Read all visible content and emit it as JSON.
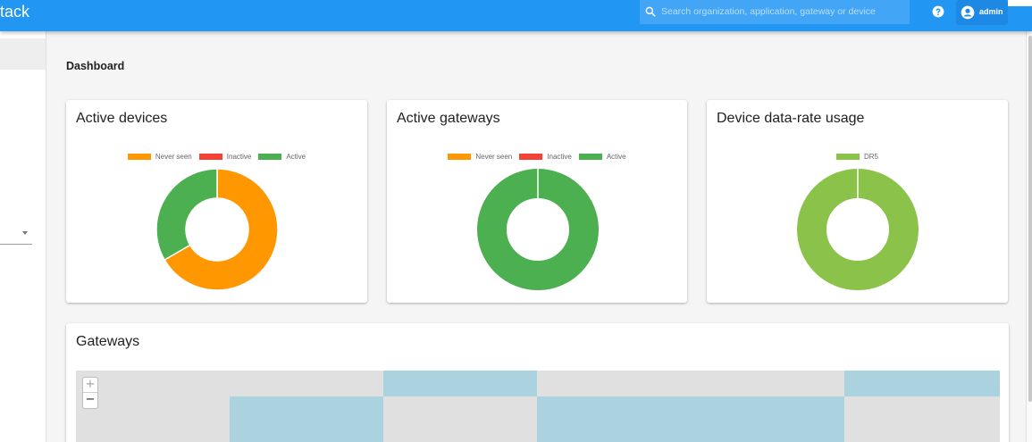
{
  "header": {
    "brand": "tack",
    "search_placeholder": "Search organization, application, gateway or device",
    "help_icon": "help-circle-icon",
    "user_icon": "account-circle-icon",
    "username": "admin"
  },
  "page": {
    "title": "Dashboard"
  },
  "cards": {
    "active_devices": {
      "title": "Active devices",
      "legend": [
        {
          "label": "Never seen",
          "color": "#ff9800"
        },
        {
          "label": "Inactive",
          "color": "#f44336"
        },
        {
          "label": "Active",
          "color": "#4caf50"
        }
      ]
    },
    "active_gateways": {
      "title": "Active gateways",
      "legend": [
        {
          "label": "Never seen",
          "color": "#ff9800"
        },
        {
          "label": "Inactive",
          "color": "#f44336"
        },
        {
          "label": "Active",
          "color": "#4caf50"
        }
      ]
    },
    "datarate": {
      "title": "Device data-rate usage",
      "legend": [
        {
          "label": "DR5",
          "color": "#8bc34a"
        }
      ]
    }
  },
  "gateways": {
    "title": "Gateways",
    "zoom_in": "+",
    "zoom_out": "−"
  },
  "chart_data": [
    {
      "type": "pie",
      "title": "Active devices",
      "categories": [
        "Never seen",
        "Inactive",
        "Active"
      ],
      "values": [
        2,
        0,
        1
      ],
      "colors": [
        "#ff9800",
        "#f44336",
        "#4caf50"
      ]
    },
    {
      "type": "pie",
      "title": "Active gateways",
      "categories": [
        "Never seen",
        "Inactive",
        "Active"
      ],
      "values": [
        0,
        0,
        1
      ],
      "colors": [
        "#ff9800",
        "#f44336",
        "#4caf50"
      ]
    },
    {
      "type": "pie",
      "title": "Device data-rate usage",
      "categories": [
        "DR5"
      ],
      "values": [
        1
      ],
      "colors": [
        "#8bc34a"
      ]
    }
  ]
}
